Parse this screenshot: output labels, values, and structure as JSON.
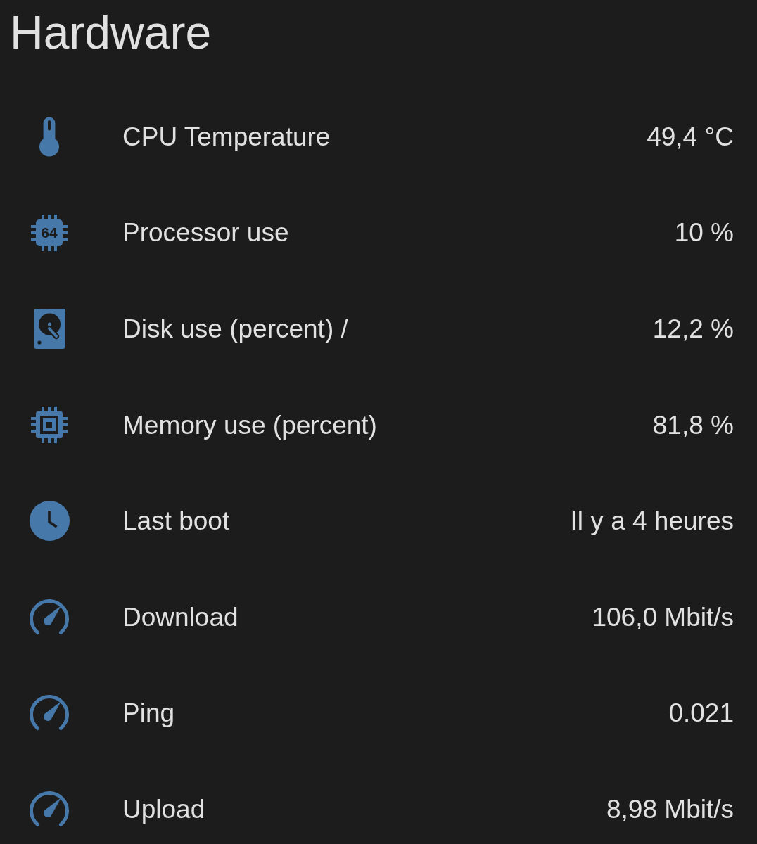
{
  "title": "Hardware",
  "rows": [
    {
      "kind": "temperature",
      "label": "CPU Temperature",
      "value": "49,4 °C"
    },
    {
      "kind": "processor",
      "label": "Processor use",
      "value": "10 %",
      "icon_text": "64"
    },
    {
      "kind": "disk",
      "label": "Disk use (percent) /",
      "value": "12,2 %"
    },
    {
      "kind": "memory",
      "label": "Memory use (percent)",
      "value": "81,8 %"
    },
    {
      "kind": "time",
      "label": "Last boot",
      "value": "Il y a 4 heures"
    },
    {
      "kind": "speed",
      "label": "Download",
      "value": "106,0 Mbit/s"
    },
    {
      "kind": "speed",
      "label": "Ping",
      "value": "0.021"
    },
    {
      "kind": "speed",
      "label": "Upload",
      "value": "8,98 Mbit/s"
    }
  ]
}
